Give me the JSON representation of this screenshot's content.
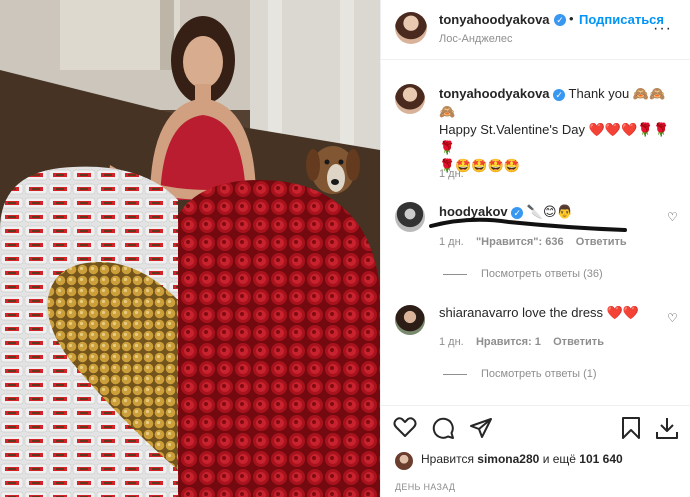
{
  "header": {
    "username": "tonyahoodyakova",
    "dot": "•",
    "follow_label": "Подписаться",
    "location": "Лос-Анджелес",
    "more": "···"
  },
  "caption": {
    "username": "tonyahoodyakova",
    "line1": "Thank you 🙈🙈",
    "line2": "🙈",
    "line3": "Happy St.Valentine's Day ❤️❤️❤️🌹🌹🌹",
    "line4": "🌹🤩🤩🤩🤩",
    "time": "1 дн."
  },
  "comments": [
    {
      "username": "hoodyakov",
      "text": "🔪😊👨",
      "time": "1 дн.",
      "likes": "\"Нравится\": 636",
      "reply": "Ответить",
      "view_replies": "Посмотреть ответы (36)"
    },
    {
      "username": "shiaranavarro",
      "text": "love the dress ❤️❤️",
      "time": "1 дн.",
      "likes": "Нравится: 1",
      "reply": "Ответить",
      "view_replies": "Посмотреть ответы (1)"
    }
  ],
  "likes": {
    "prefix": "Нравится",
    "user": "simona280",
    "middle": "и ещё",
    "count": "101 640"
  },
  "date": "ДЕНЬ НАЗАД",
  "icons": {
    "like": "heart-icon",
    "comment": "comment-icon",
    "share": "send-icon",
    "save": "bookmark-icon",
    "download": "download-icon"
  }
}
